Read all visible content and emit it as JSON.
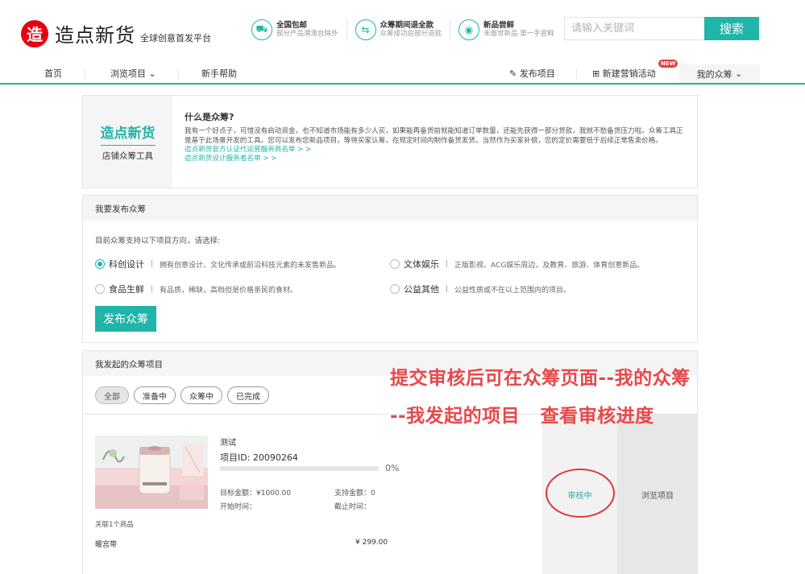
{
  "header": {
    "logo_mark": "造",
    "logo_name": "造点新货",
    "logo_tagline": "全球创意首发平台",
    "features": [
      {
        "icon": "truck-icon",
        "glyph": "⛟",
        "title": "全国包邮",
        "desc": "部分产品港澳台除外"
      },
      {
        "icon": "refund-icon",
        "glyph": "⇆",
        "title": "众筹期间退全款",
        "desc": "众筹成功后部分退款"
      },
      {
        "icon": "speaker-icon",
        "glyph": "◉",
        "title": "新品尝鲜",
        "desc": "未面世新品 第一手尝鲜"
      }
    ],
    "search_placeholder": "请输入关键词",
    "search_button": "搜索"
  },
  "nav": {
    "home": "首页",
    "browse": "浏览项目",
    "browse_caret": "⌄",
    "help": "新手帮助",
    "publish": "发布项目",
    "publish_glyph": "✎",
    "campaign": "新建营销活动",
    "campaign_glyph": "⊞",
    "new_badge": "NEW",
    "mine": "我的众筹",
    "mine_caret": "⌄"
  },
  "intro": {
    "brand": "造点新货",
    "subtitle": "店铺众筹工具",
    "question": "什么是众筹?",
    "text": "我有一个好点子，可惜没有启动资金，也不知道市场能有多少人买，如果能再备货前就能知道订单数量，还能先获得一部分货款，我就不愁备货压力啦。众筹工具正是基于此场景开发的工具。您可以发布您新品项目，等待买家认筹，在规定时间内制作备货发货。当然作为买家补偿，您的定价需要低于后续正常售卖价格。",
    "link1": "造点新货官方认证代运营服务商名单 > >",
    "link2": "造点新货设计服务者名单 > >"
  },
  "publish": {
    "heading": "我要发布众筹",
    "hint": "目前众筹支持以下项目方向，请选择:",
    "options": [
      {
        "name": "科创设计",
        "desc": "拥有创意设计、文化传承或前沿科技元素的未发售新品。",
        "selected": true
      },
      {
        "name": "文体娱乐",
        "desc": "正版影视、ACG娱乐周边，及教育、旅游、体育创意新品。",
        "selected": false
      },
      {
        "name": "食品生鲜",
        "desc": "有品质，稀缺，高档但是价格亲民的食材。",
        "selected": false
      },
      {
        "name": "公益其他",
        "desc": "公益性质或不在以上范围内的项目。",
        "selected": false
      }
    ],
    "separator": "|",
    "button": "发布众筹"
  },
  "mine": {
    "heading": "我发起的众筹项目",
    "filters": [
      "全部",
      "准备中",
      "众筹中",
      "已完成"
    ],
    "project": {
      "name": "测试",
      "id_label": "项目ID: 20090264",
      "progress_percent": 0,
      "progress_text": "0%",
      "target_label": "目标金额：¥1000.00",
      "support_label": "支持金额：0",
      "start_label": "开始时间：",
      "end_label": "截止时间：",
      "linked_goods": "关联1个商品",
      "goods_name": "暖宫带",
      "goods_price": "¥ 299.00",
      "status": "审核中",
      "view_button": "浏览项目"
    }
  },
  "annotation": {
    "line1": "提交审核后可在众筹页面--我的众筹",
    "line2": "--我发起的项目   查看审核进度"
  },
  "colors": {
    "accent": "#1fb5a8",
    "logo_red": "#e60012",
    "annotation_red": "#e8484b"
  }
}
